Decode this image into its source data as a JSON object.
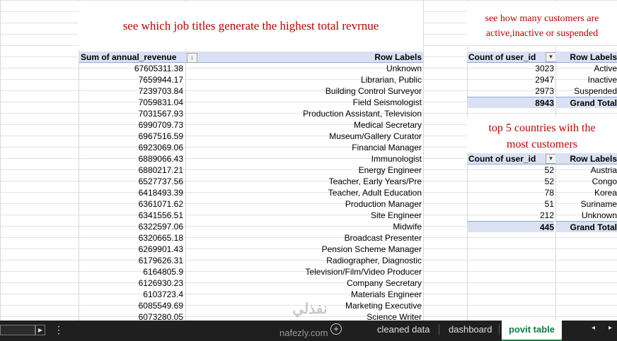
{
  "titles": {
    "job": "see which job titles generate the highest total revrnue",
    "status_line1": "see how many customers are",
    "status_line2": "active,inactive or suspended",
    "countries_line1": "top 5 countries with the",
    "countries_line2": "most customers"
  },
  "revenue_pivot": {
    "value_header": "Sum of annual_revenue",
    "label_header": "Row Labels",
    "rows": [
      [
        "67605311.38",
        "Unknown"
      ],
      [
        "7659944.17",
        "Librarian, Public"
      ],
      [
        "7239703.84",
        "Building Control Surveyor"
      ],
      [
        "7059831.04",
        "Field Seismologist"
      ],
      [
        "7031567.93",
        "Production Assistant, Television"
      ],
      [
        "6990709.73",
        "Medical Secretary"
      ],
      [
        "6967516.59",
        "Museum/Gallery Curator"
      ],
      [
        "6923069.06",
        "Financial Manager"
      ],
      [
        "6889066.43",
        "Immunologist"
      ],
      [
        "6880217.21",
        "Energy Engineer"
      ],
      [
        "6527737.56",
        "Teacher, Early Years/Pre"
      ],
      [
        "6418493.39",
        "Teacher, Adult Education"
      ],
      [
        "6361071.62",
        "Production Manager"
      ],
      [
        "6341556.51",
        "Site Engineer"
      ],
      [
        "6322597.06",
        "Midwife"
      ],
      [
        "6320665.18",
        "Broadcast Presenter"
      ],
      [
        "6269901.43",
        "Pension Scheme Manager"
      ],
      [
        "6179626.31",
        "Radiographer, Diagnostic"
      ],
      [
        "6164805.9",
        "Television/Film/Video Producer"
      ],
      [
        "6126930.23",
        "Company Secretary"
      ],
      [
        "6103723.4",
        "Materials Engineer"
      ],
      [
        "6085549.69",
        "Marketing Executive"
      ],
      [
        "6073280.05",
        "Science Writer"
      ]
    ]
  },
  "status_pivot": {
    "value_header": "Count of user_id",
    "label_header": "Row Labels",
    "rows": [
      [
        "3023",
        "Active"
      ],
      [
        "2947",
        "Inactive"
      ],
      [
        "2973",
        "Suspended"
      ]
    ],
    "total": [
      "8943",
      "Grand Total"
    ]
  },
  "country_pivot": {
    "value_header": "Count of user_id",
    "label_header": "Row Labels",
    "rows": [
      [
        "52",
        "Austria"
      ],
      [
        "52",
        "Congo"
      ],
      [
        "78",
        "Korea"
      ],
      [
        "51",
        "Suriname"
      ],
      [
        "212",
        "Unknown"
      ]
    ],
    "total": [
      "445",
      "Grand Total"
    ]
  },
  "tabs": {
    "cleaned": "cleaned data",
    "dashboard": "dashboard",
    "pivot": "povit table"
  },
  "watermark": {
    "arabic": "نفذلي",
    "latin": "nafezly.com"
  },
  "colors": {
    "title_red": "#c00000",
    "pivot_header": "#d9e1f2",
    "active_tab": "#107c41"
  }
}
